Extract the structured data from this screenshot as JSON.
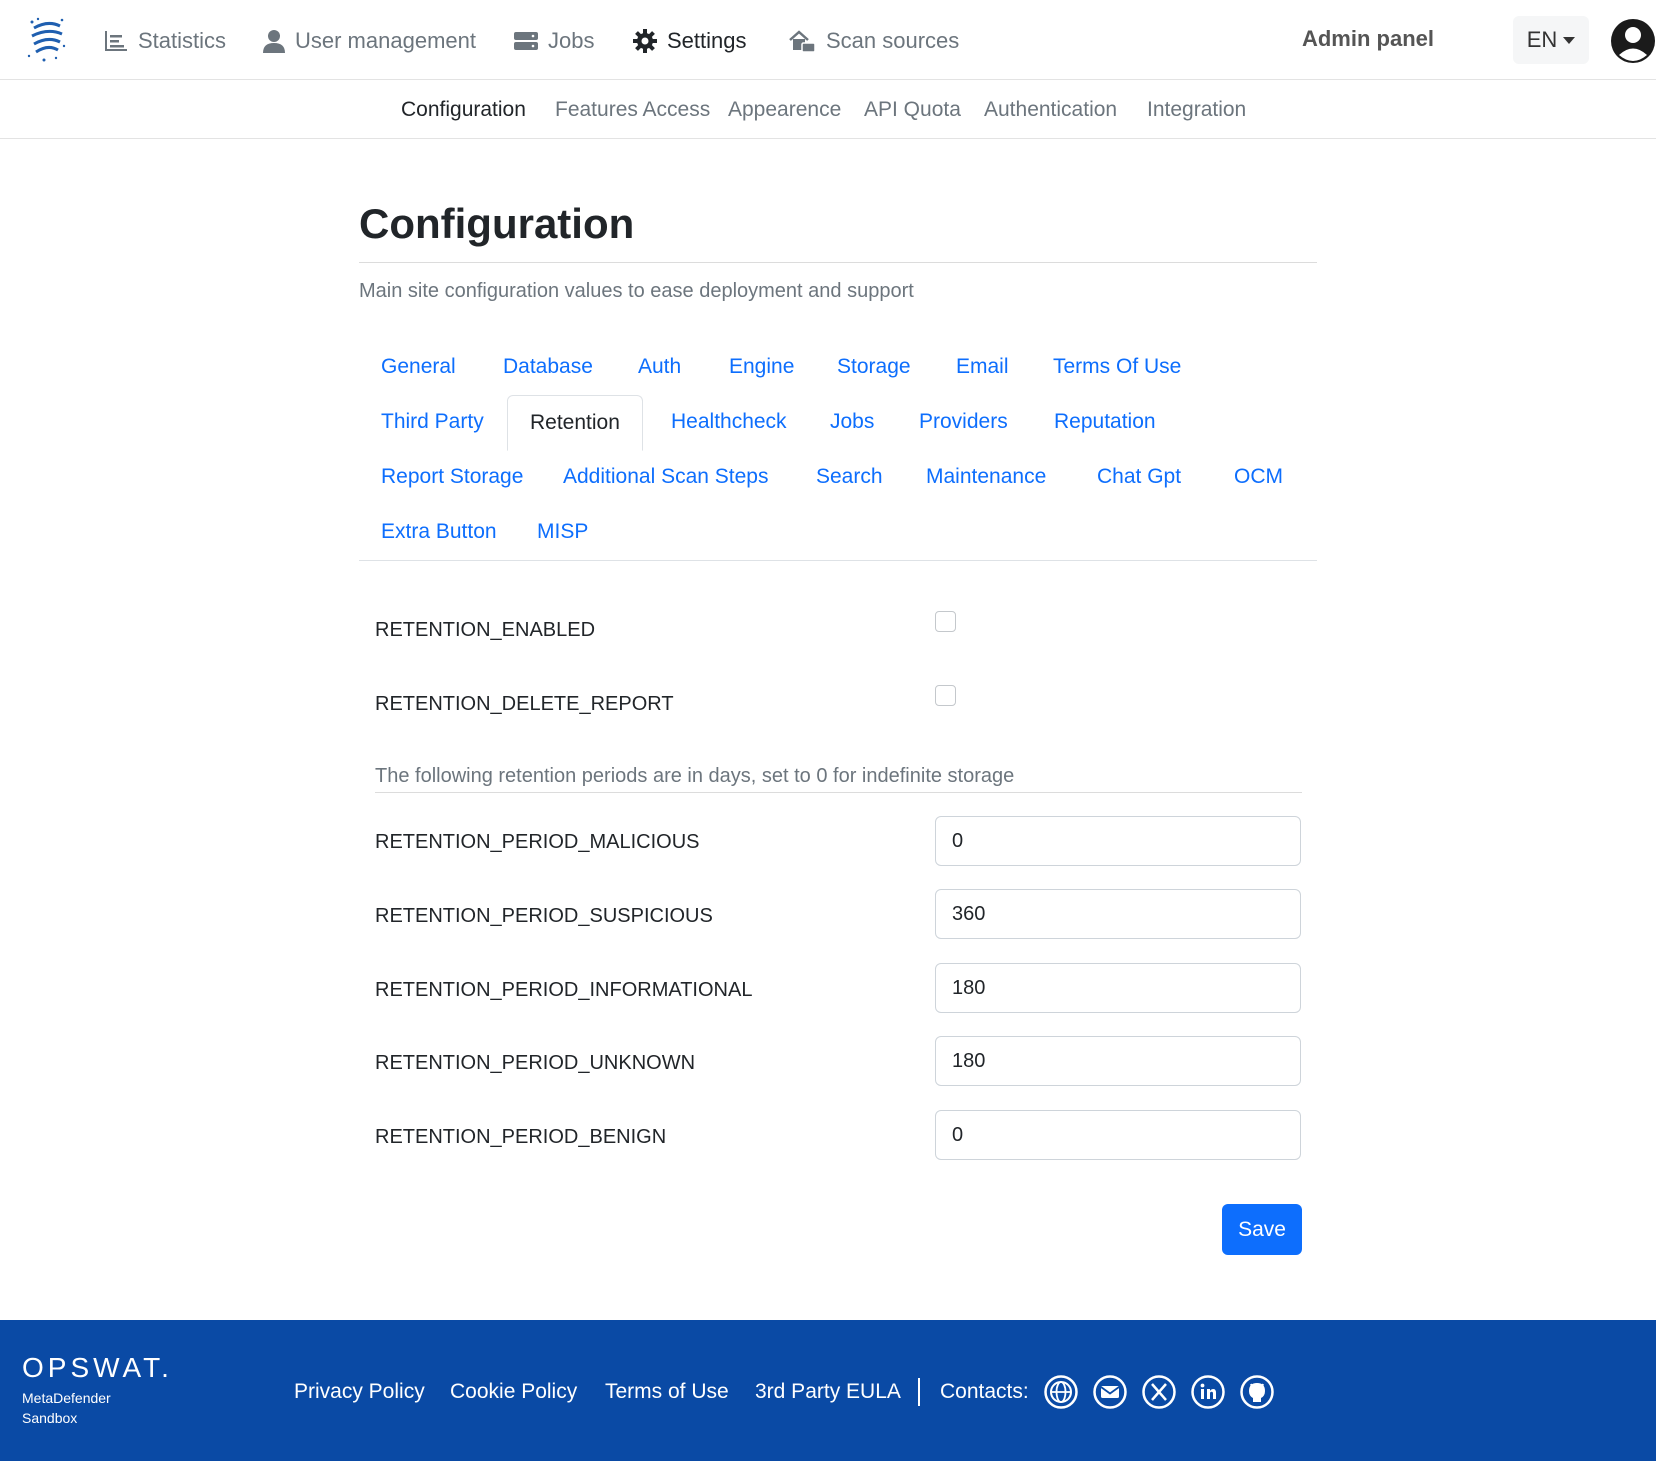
{
  "topnav": {
    "items": [
      {
        "label": "Statistics",
        "icon": "chart-icon"
      },
      {
        "label": "User management",
        "icon": "user-icon"
      },
      {
        "label": "Jobs",
        "icon": "server-icon"
      },
      {
        "label": "Settings",
        "icon": "gear-icon",
        "active": true
      },
      {
        "label": "Scan sources",
        "icon": "scan-sources-icon"
      }
    ],
    "admin_label": "Admin panel",
    "language": "EN"
  },
  "subnav": {
    "items": [
      "Configuration",
      "Features Access",
      "Appearence",
      "API Quota",
      "Authentication",
      "Integration"
    ],
    "active": "Configuration"
  },
  "page": {
    "title": "Configuration",
    "description": "Main site configuration values to ease deployment and support"
  },
  "tabs": {
    "items": [
      "General",
      "Database",
      "Auth",
      "Engine",
      "Storage",
      "Email",
      "Terms Of Use",
      "Third Party",
      "Retention",
      "Healthcheck",
      "Jobs",
      "Providers",
      "Reputation",
      "Report Storage",
      "Additional Scan Steps",
      "Search",
      "Maintenance",
      "Chat Gpt",
      "OCM",
      "Extra Button",
      "MISP"
    ],
    "active": "Retention"
  },
  "form": {
    "checkboxes": [
      {
        "label": "RETENTION_ENABLED",
        "checked": false
      },
      {
        "label": "RETENTION_DELETE_REPORT",
        "checked": false
      }
    ],
    "note": "The following retention periods are in days, set to 0 for indefinite storage",
    "fields": [
      {
        "label": "RETENTION_PERIOD_MALICIOUS",
        "value": "0"
      },
      {
        "label": "RETENTION_PERIOD_SUSPICIOUS",
        "value": "360"
      },
      {
        "label": "RETENTION_PERIOD_INFORMATIONAL",
        "value": "180"
      },
      {
        "label": "RETENTION_PERIOD_UNKNOWN",
        "value": "180"
      },
      {
        "label": "RETENTION_PERIOD_BENIGN",
        "value": "0"
      }
    ],
    "save_label": "Save"
  },
  "footer": {
    "brand": "OPSWAT.",
    "product_line1": "MetaDefender",
    "product_line2": "Sandbox",
    "links": [
      "Privacy Policy",
      "Cookie Policy",
      "Terms of Use",
      "3rd Party EULA"
    ],
    "contacts_label": "Contacts:",
    "social_icons": [
      "globe-icon",
      "mail-icon",
      "x-icon",
      "linkedin-icon",
      "github-icon"
    ]
  },
  "colors": {
    "link_blue": "#0d6efd",
    "footer_blue": "#0a4aa5",
    "muted": "#6c757d"
  }
}
